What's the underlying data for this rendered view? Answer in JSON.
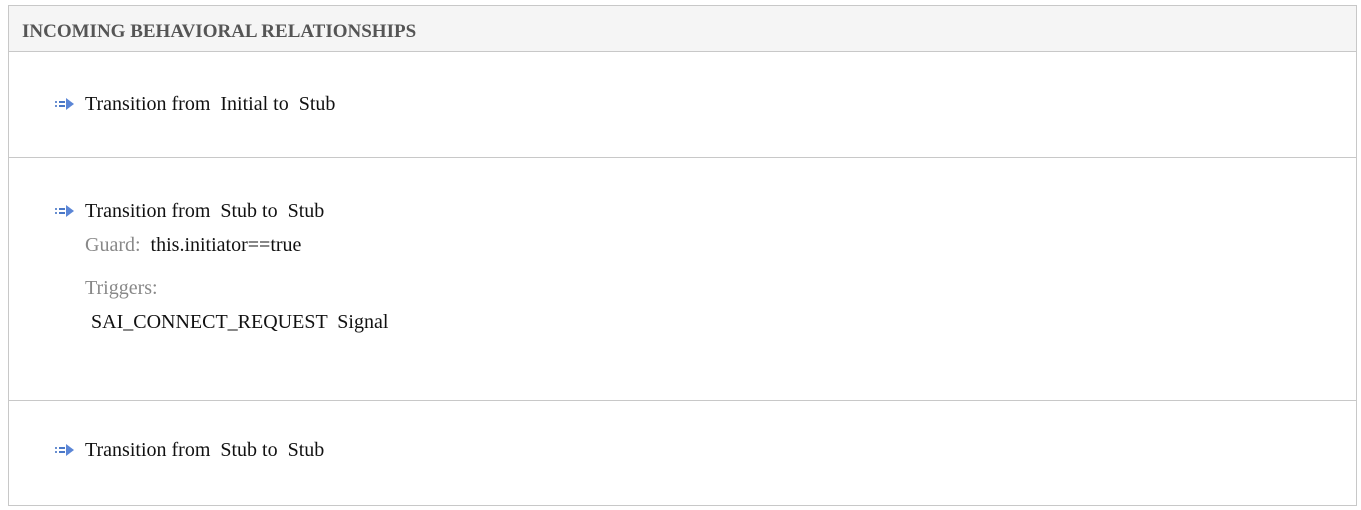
{
  "section_title": "INCOMING BEHAVIORAL RELATIONSHIPS",
  "relationships": [
    {
      "icon": "transition-arrow-icon",
      "text": "Transition from  Initial to  Stub"
    },
    {
      "icon": "transition-arrow-icon",
      "text": "Transition from  Stub to  Stub",
      "guard_label": "Guard:",
      "guard_value": "this.initiator==true",
      "triggers_label": "Triggers:",
      "trigger": "SAI_CONNECT_REQUEST  Signal"
    },
    {
      "icon": "transition-arrow-icon",
      "text": "Transition from  Stub to  Stub"
    }
  ],
  "colors": {
    "icon": "#4a78c8",
    "label": "#888888",
    "border": "#c8c8c8"
  }
}
